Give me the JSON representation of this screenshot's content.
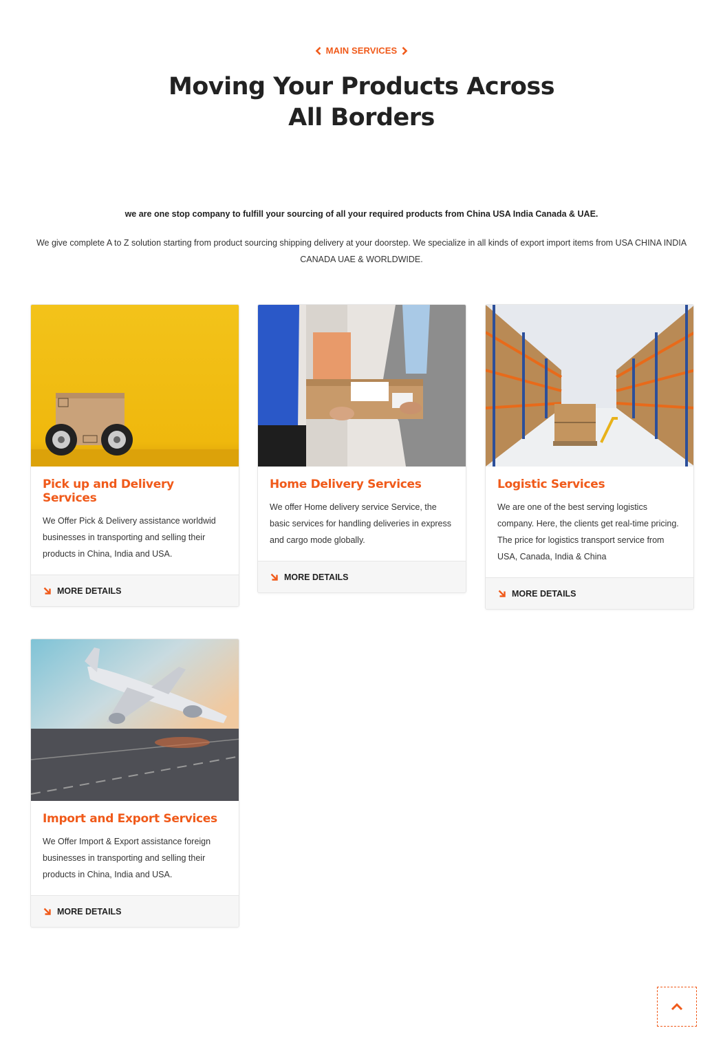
{
  "header": {
    "tag": "MAIN SERVICES",
    "title_line1": "Moving Your Products Across",
    "title_line2": "All Borders"
  },
  "intro": {
    "bold": "we are one stop company to fulfill your sourcing of all your required products from China USA India Canada & UAE.",
    "text": "We give complete A to Z solution starting from product sourcing shipping delivery at your doorstep. We specialize in all kinds of export import items from USA CHINA INDIA CANADA UAE & WORLDWIDE."
  },
  "cards": [
    {
      "title": "Pick up and Delivery Services",
      "desc": "We Offer Pick & Delivery assistance worldwid businesses in transporting and selling their products in China, India and USA.",
      "cta": "MORE DETAILS"
    },
    {
      "title": "Home Delivery Services",
      "desc": "We offer Home delivery service Service, the basic services for handling deliveries in express and cargo mode globally.",
      "cta": "MORE DETAILS"
    },
    {
      "title": "Logistic Services",
      "desc": "We are one of the best serving logistics company. Here, the clients get real-time pricing. The price for logistics transport service from USA, Canada, India & China",
      "cta": "MORE DETAILS"
    },
    {
      "title": "Import and Export Services",
      "desc": "We Offer Import & Export assistance foreign businesses in transporting and selling their products in China, India and USA.",
      "cta": "MORE DETAILS"
    }
  ],
  "icons": {
    "tag_left": "chevron-left-icon",
    "tag_right": "chevron-right-icon",
    "cta": "arrow-down-right-icon",
    "back_to_top": "chevron-up-icon"
  },
  "colors": {
    "accent": "#f05a1a",
    "heading": "#222222",
    "footer_bg": "#f6f6f6"
  }
}
